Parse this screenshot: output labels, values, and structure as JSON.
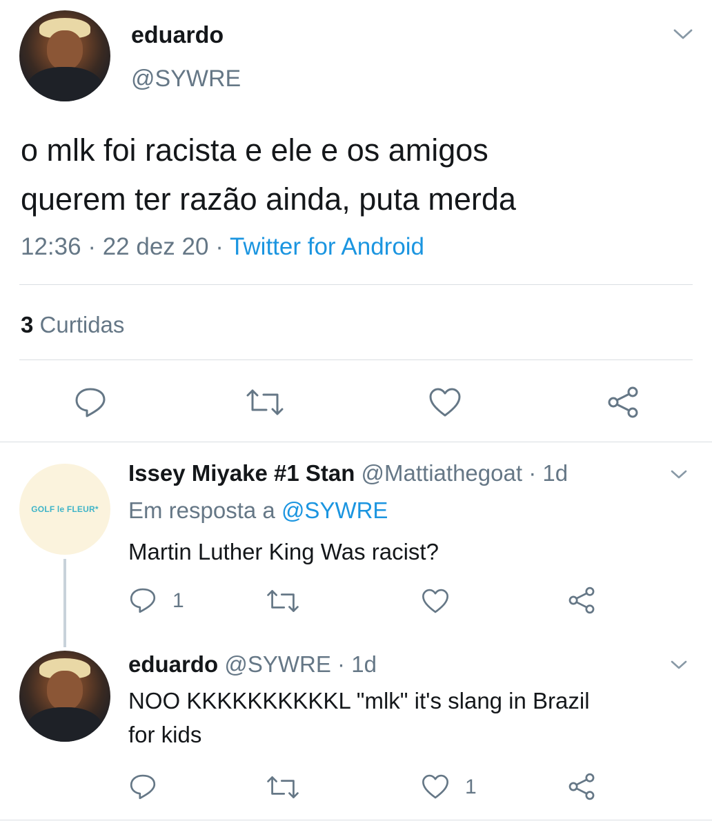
{
  "main_tweet": {
    "display_name": "eduardo",
    "handle": "@SYWRE",
    "text_line1": "o mlk foi racista e ele e os amigos",
    "text_line2": "querem ter razão ainda, puta merda",
    "time": "12:36",
    "date": "22 dez 20",
    "source": "Twitter for Android",
    "separator": "·",
    "likes_count": "3",
    "likes_label": "Curtidas"
  },
  "reply1": {
    "display_name": "Issey Miyake #1 Stan",
    "handle": "@Mattiathegoat",
    "age": "1d",
    "reply_prefix": "Em resposta a",
    "reply_to": "@SYWRE",
    "text": "Martin Luther King Was racist?",
    "reply_count": "1",
    "avatar_logo_text": "GOLF le FLEUR*"
  },
  "reply2": {
    "display_name": "eduardo",
    "handle": "@SYWRE",
    "age": "1d",
    "text_line1": "NOO KKKKKKKKKKL \"mlk\" it's slang in Brazil",
    "text_line2": "for kids",
    "like_count": "1"
  },
  "icons": [
    "chevron-down-icon",
    "reply-icon",
    "retweet-icon",
    "like-icon",
    "share-icon"
  ],
  "colors": {
    "link": "#1b95e0",
    "muted": "#657786",
    "text": "#14171a",
    "divider": "#d9dee2",
    "thread_line": "#c8d2da"
  }
}
